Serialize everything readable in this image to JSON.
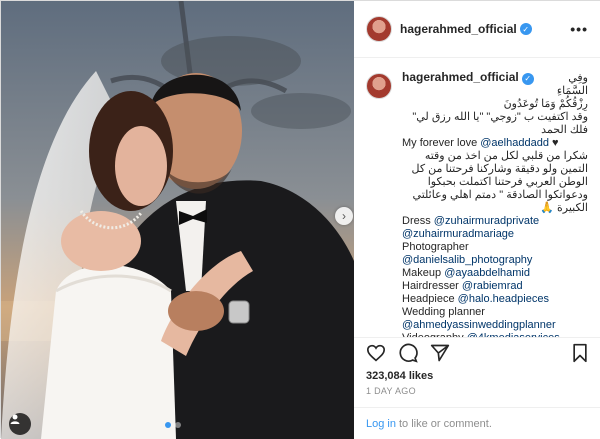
{
  "post": {
    "username": "hagerahmed_official",
    "verified_mark": "✓",
    "more_label": "•••"
  },
  "caption": {
    "username": "hagerahmed_official",
    "lines": [
      {
        "text": "وفِي السَّمَاءِ",
        "dir": "rtl",
        "kind": "first"
      },
      {
        "text": "رِزْقُكُمْ وَمَا تُوعَدُونَ",
        "dir": "rtl",
        "kind": "text"
      },
      {
        "text": "وقد اكتفيت ب \"زوجي\" \"يا الله رزق لي\" فلك الحمد",
        "dir": "rtl",
        "kind": "text"
      },
      {
        "text": "My forever love",
        "mention": "@aelhaddadd",
        "suffix": " ♥",
        "dir": "ltr",
        "kind": "mixed"
      },
      {
        "text": "شكرا من قلبي لكل من اخذ من وقته التمين ولو دقيقة وشاركنا فرحتنا من كل الوطن العربي فرحتنا اكتملت بحبكوا ودعواتكوا الصادقة \" دمتم اهلي وعائلتي الكبيرة 🙏",
        "dir": "rtl",
        "kind": "text"
      },
      {
        "text": "Dress",
        "mention": "@zuhairmuradprivate",
        "dir": "ltr",
        "kind": "mixed"
      },
      {
        "mention": "@zuhairmuradmariage",
        "dir": "ltr",
        "kind": "mention"
      },
      {
        "text": "Photographer",
        "dir": "ltr",
        "kind": "text"
      },
      {
        "mention": "@danielsalib_photography",
        "dir": "ltr",
        "kind": "mention"
      },
      {
        "text": "Makeup",
        "mention": "@ayaabdelhamid",
        "dir": "ltr",
        "kind": "mixed"
      },
      {
        "text": "Hairdresser",
        "mention": "@rabiemrad",
        "dir": "ltr",
        "kind": "mixed"
      },
      {
        "text": "Headpiece",
        "mention": "@halo.headpieces",
        "dir": "ltr",
        "kind": "mixed"
      },
      {
        "text": "Wedding planner",
        "dir": "ltr",
        "kind": "text"
      },
      {
        "mention": "@ahmedyassinweddingplanner",
        "dir": "ltr",
        "kind": "mention"
      },
      {
        "text": "Videography",
        "mention": "@4kmediaservices",
        "dir": "ltr",
        "kind": "mixed"
      }
    ]
  },
  "stats": {
    "likes": "323,084 likes",
    "ago": "1 DAY AGO"
  },
  "login_bar": {
    "login": "Log in",
    "rest": "to like or comment."
  },
  "icons": [
    "heart-icon",
    "comment-icon",
    "share-icon",
    "bookmark-icon",
    "user-tag-icon",
    "next-arrow-icon"
  ],
  "colors": {
    "link": "#003569",
    "accent": "#3897f0",
    "muted": "#8e8e8e"
  }
}
